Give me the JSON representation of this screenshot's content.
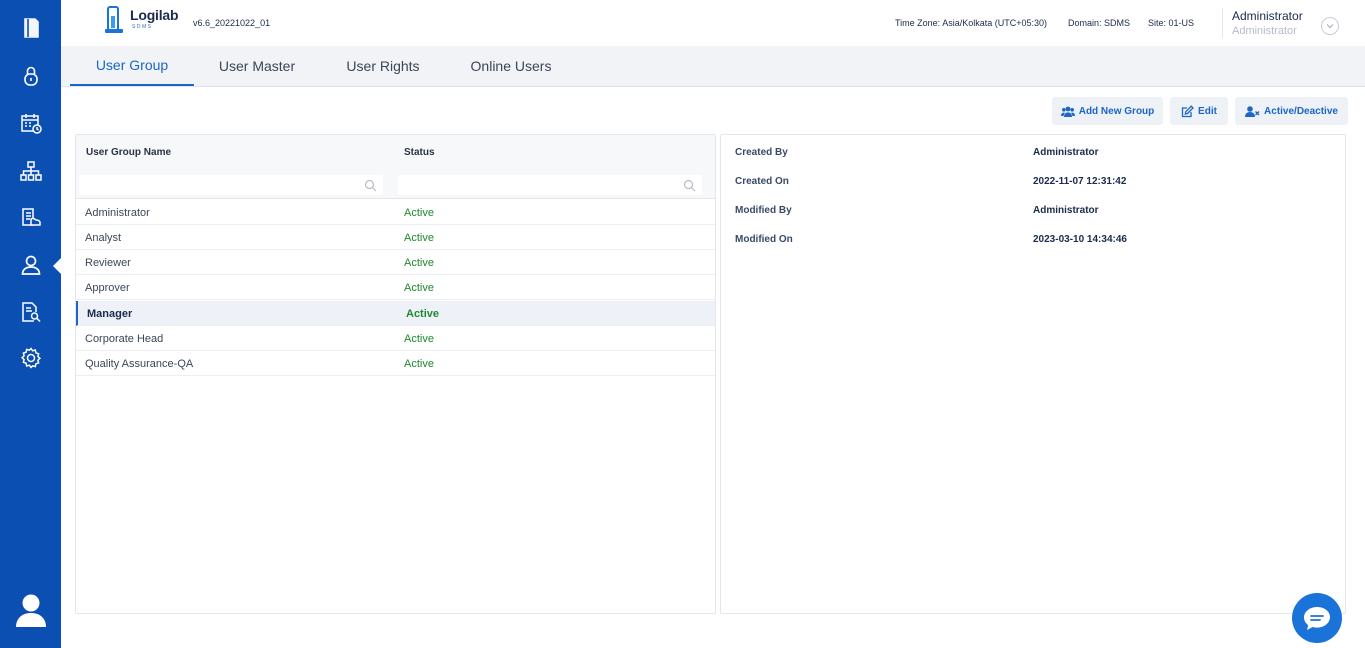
{
  "header": {
    "logo_name": "Logilab",
    "logo_sub": "SDMS",
    "version": "v6.6_20221022_01",
    "timezone_label": "Time Zone:",
    "timezone_value": "Asia/Kolkata (UTC+05:30)",
    "domain_label": "Domain:",
    "domain_value": "SDMS",
    "site_label": "Site:",
    "site_value": "01-US",
    "user_name": "Administrator",
    "user_role": "Administrator"
  },
  "sidebar": {
    "items": [
      {
        "name": "sidebar-item-documents",
        "icon": "document-icon"
      },
      {
        "name": "sidebar-item-lock",
        "icon": "lock-icon"
      },
      {
        "name": "sidebar-item-schedule",
        "icon": "calendar-clock-icon"
      },
      {
        "name": "sidebar-item-hierarchy",
        "icon": "hierarchy-icon"
      },
      {
        "name": "sidebar-item-reports",
        "icon": "report-icon"
      },
      {
        "name": "sidebar-item-users",
        "icon": "user-icon"
      },
      {
        "name": "sidebar-item-audit",
        "icon": "document-search-icon"
      },
      {
        "name": "sidebar-item-settings",
        "icon": "gear-icon"
      }
    ],
    "active": "sidebar-item-users"
  },
  "tabs": [
    {
      "label": "User Group",
      "active": true
    },
    {
      "label": "User Master",
      "active": false
    },
    {
      "label": "User Rights",
      "active": false
    },
    {
      "label": "Online Users",
      "active": false
    }
  ],
  "toolbar": {
    "add_label": "Add New Group",
    "edit_label": "Edit",
    "toggle_label": "Active/Deactive"
  },
  "grid": {
    "columns": [
      "User Group Name",
      "Status"
    ],
    "filter_placeholder": "",
    "rows": [
      {
        "name": "Administrator",
        "status": "Active"
      },
      {
        "name": "Analyst",
        "status": "Active"
      },
      {
        "name": "Reviewer",
        "status": "Active"
      },
      {
        "name": "Approver",
        "status": "Active"
      },
      {
        "name": "Manager",
        "status": "Active"
      },
      {
        "name": "Corporate Head",
        "status": "Active"
      },
      {
        "name": "Quality Assurance-QA",
        "status": "Active"
      }
    ],
    "selected_index": 4
  },
  "details": {
    "created_by_label": "Created By",
    "created_by": "Administrator",
    "created_on_label": "Created On",
    "created_on": "2022-11-07 12:31:42",
    "modified_by_label": "Modified By",
    "modified_by": "Administrator",
    "modified_on_label": "Modified On",
    "modified_on": "2023-03-10 14:34:46"
  },
  "colors": {
    "sidebar": "#0b4fb3",
    "accent": "#1a66c9",
    "status_active": "#1e8a2c"
  }
}
